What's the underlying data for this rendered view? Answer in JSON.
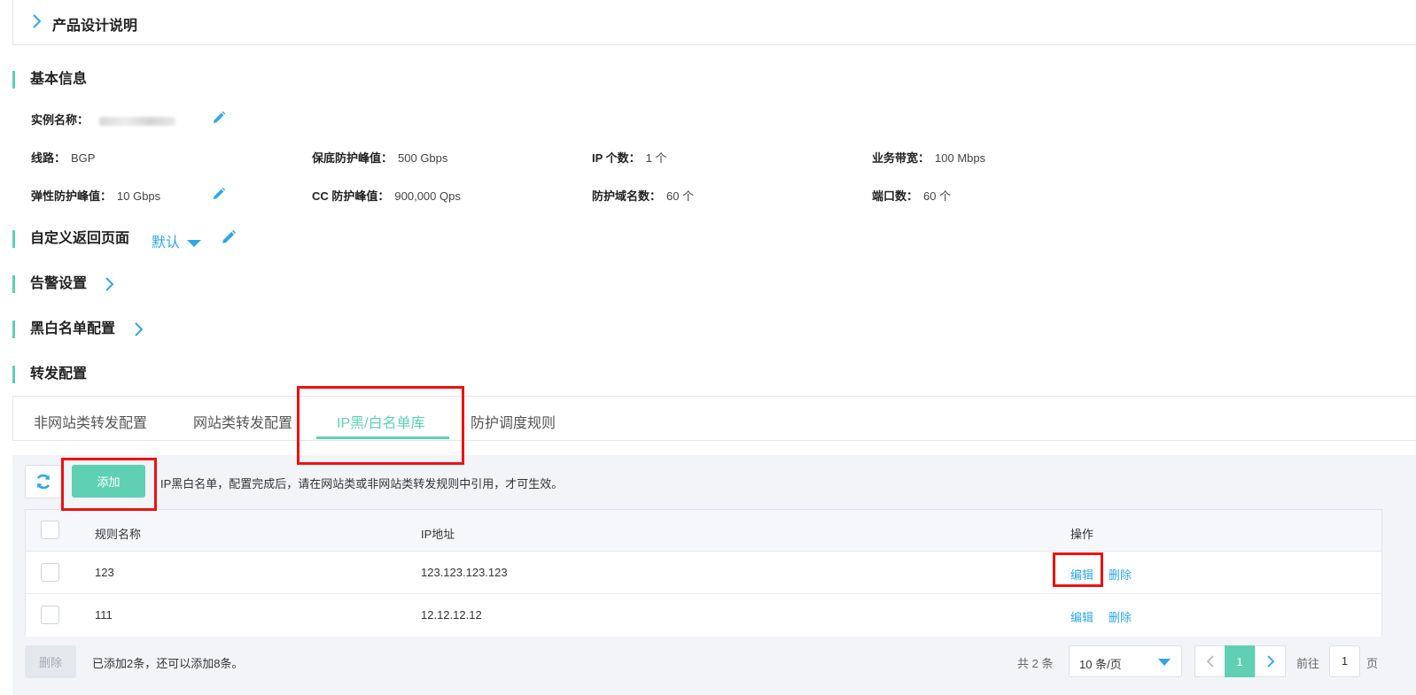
{
  "design_header": {
    "title": "产品设计说明"
  },
  "sections": {
    "basic_info": "基本信息",
    "custom_return": "自定义返回页面",
    "alarm": "告警设置",
    "blackwhite": "黑白名单配置",
    "forward": "转发配置"
  },
  "basic": {
    "instance_label": "实例名称：",
    "route_label": "线路：",
    "route_value": "BGP",
    "base_protect_label": "保底防护峰值：",
    "base_protect_value": "500 Gbps",
    "ip_count_label": "IP 个数：",
    "ip_count_value": "1 个",
    "bandwidth_label": "业务带宽：",
    "bandwidth_value": "100 Mbps",
    "elastic_label": "弹性防护峰值：",
    "elastic_value": "10 Gbps",
    "cc_label": "CC 防护峰值：",
    "cc_value": "900,000 Qps",
    "domains_label": "防护域名数：",
    "domains_value": "60 个",
    "ports_label": "端口数：",
    "ports_value": "60 个"
  },
  "custom_return": {
    "selected": "默认"
  },
  "tabs": [
    "非网站类转发配置",
    "网站类转发配置",
    "IP黑/白名单库",
    "防护调度规则"
  ],
  "toolbar": {
    "add_label": "添加",
    "hint": "IP黑白名单，配置完成后，请在网站类或非网站类转发规则中引用，才可生效。"
  },
  "table": {
    "headers": {
      "name": "规则名称",
      "ip": "IP地址",
      "ops": "操作"
    },
    "rows": [
      {
        "name": "123",
        "ip": "123.123.123.123",
        "edit": "编辑",
        "delete": "删除"
      },
      {
        "name": "111",
        "ip": "12.12.12.12",
        "edit": "编辑",
        "delete": "删除"
      }
    ]
  },
  "footer": {
    "delete_label": "删除",
    "note": "已添加2条，还可以添加8条。",
    "total": "共 2 条",
    "page_size": "10 条/页",
    "current_page": "1",
    "goto_label": "前往",
    "goto_value": "1",
    "goto_unit": "页"
  },
  "colors": {
    "accent": "#5fd0b4",
    "link": "#2fa7e3",
    "highlight": "#ee1111"
  }
}
